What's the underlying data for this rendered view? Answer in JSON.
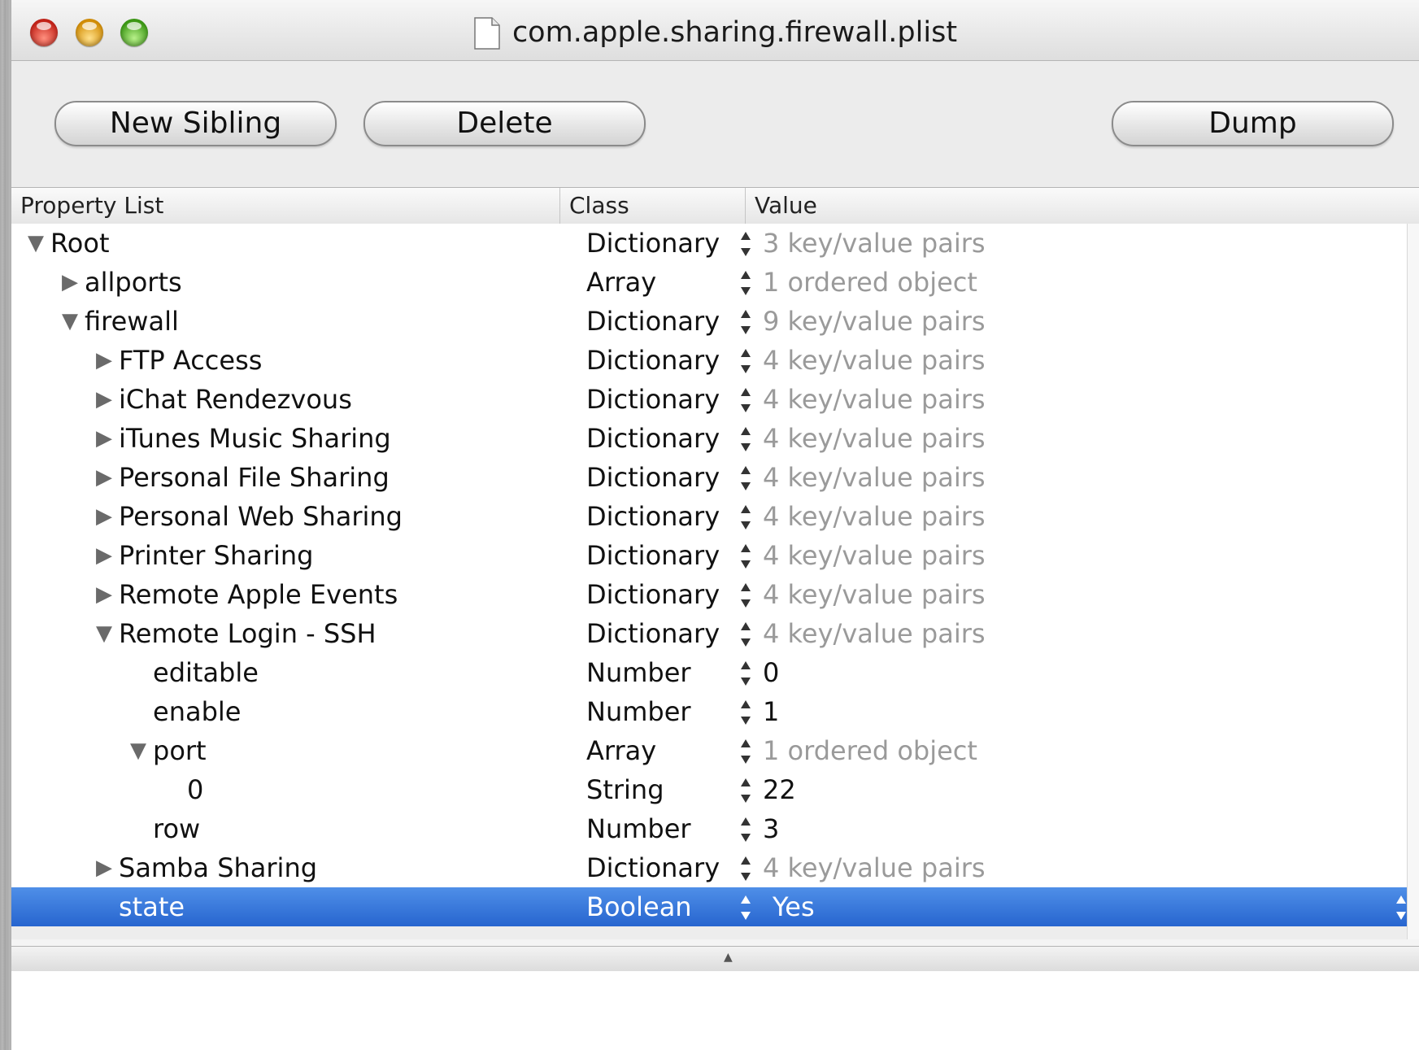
{
  "window": {
    "title": "com.apple.sharing.firewall.plist"
  },
  "toolbar": {
    "new_sibling_label": "New Sibling",
    "delete_label": "Delete",
    "dump_label": "Dump"
  },
  "table": {
    "headers": {
      "property": "Property List",
      "class": "Class",
      "value": "Value"
    },
    "rows": [
      {
        "key": "Root",
        "class": "Dictionary",
        "value": "3 key/value pairs",
        "depth": 0,
        "disclosure": "expanded",
        "muted": true
      },
      {
        "key": "allports",
        "class": "Array",
        "value": "1 ordered object",
        "depth": 1,
        "disclosure": "collapsed",
        "muted": true
      },
      {
        "key": "firewall",
        "class": "Dictionary",
        "value": "9 key/value pairs",
        "depth": 1,
        "disclosure": "expanded",
        "muted": true
      },
      {
        "key": "FTP Access",
        "class": "Dictionary",
        "value": "4 key/value pairs",
        "depth": 2,
        "disclosure": "collapsed",
        "muted": true
      },
      {
        "key": "iChat Rendezvous",
        "class": "Dictionary",
        "value": "4 key/value pairs",
        "depth": 2,
        "disclosure": "collapsed",
        "muted": true
      },
      {
        "key": "iTunes Music Sharing",
        "class": "Dictionary",
        "value": "4 key/value pairs",
        "depth": 2,
        "disclosure": "collapsed",
        "muted": true
      },
      {
        "key": "Personal File Sharing",
        "class": "Dictionary",
        "value": "4 key/value pairs",
        "depth": 2,
        "disclosure": "collapsed",
        "muted": true
      },
      {
        "key": "Personal Web Sharing",
        "class": "Dictionary",
        "value": "4 key/value pairs",
        "depth": 2,
        "disclosure": "collapsed",
        "muted": true
      },
      {
        "key": "Printer Sharing",
        "class": "Dictionary",
        "value": "4 key/value pairs",
        "depth": 2,
        "disclosure": "collapsed",
        "muted": true
      },
      {
        "key": "Remote Apple Events",
        "class": "Dictionary",
        "value": "4 key/value pairs",
        "depth": 2,
        "disclosure": "collapsed",
        "muted": true
      },
      {
        "key": "Remote Login - SSH",
        "class": "Dictionary",
        "value": "4 key/value pairs",
        "depth": 2,
        "disclosure": "expanded",
        "muted": true
      },
      {
        "key": "editable",
        "class": "Number",
        "value": "0",
        "depth": 3,
        "disclosure": "none",
        "muted": false
      },
      {
        "key": "enable",
        "class": "Number",
        "value": "1",
        "depth": 3,
        "disclosure": "none",
        "muted": false
      },
      {
        "key": "port",
        "class": "Array",
        "value": "1 ordered object",
        "depth": 3,
        "disclosure": "expanded",
        "muted": true
      },
      {
        "key": "0",
        "class": "String",
        "value": "22",
        "depth": 4,
        "disclosure": "none",
        "muted": false
      },
      {
        "key": "row",
        "class": "Number",
        "value": "3",
        "depth": 3,
        "disclosure": "none",
        "muted": false
      },
      {
        "key": "Samba Sharing",
        "class": "Dictionary",
        "value": "4 key/value pairs",
        "depth": 2,
        "disclosure": "collapsed",
        "muted": true
      },
      {
        "key": "state",
        "class": "Boolean",
        "value": "Yes",
        "depth": 2,
        "disclosure": "none",
        "muted": false,
        "selected": true
      }
    ]
  },
  "colors": {
    "selection": "#3a7be0",
    "muted_text": "#9a9a9a",
    "window_bg": "#ededed"
  },
  "icons": {
    "document": "document-icon",
    "expanded": "triangle-down-icon",
    "collapsed": "triangle-right-icon",
    "stepper": "stepper-arrows-icon"
  }
}
